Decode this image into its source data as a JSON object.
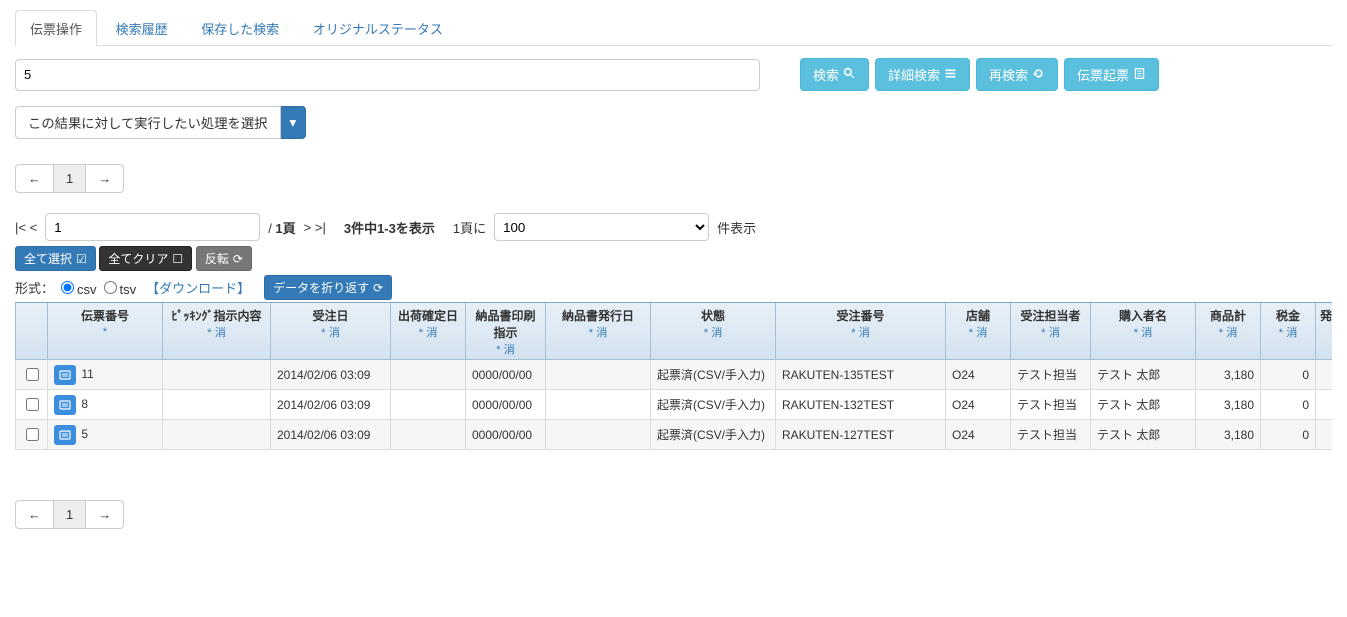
{
  "tabs": {
    "items": [
      {
        "label": "伝票操作",
        "active": true
      },
      {
        "label": "検索履歴"
      },
      {
        "label": "保存した検索"
      },
      {
        "label": "オリジナルステータス"
      }
    ]
  },
  "search": {
    "value": "5",
    "btn_search": "検索",
    "btn_advanced": "詳細検索",
    "btn_research": "再検索",
    "btn_issue": "伝票起票"
  },
  "action": {
    "label": "この結果に対して実行したい処理を選択"
  },
  "pagination": {
    "prev": "←",
    "page": "1",
    "next": "→"
  },
  "page_controls": {
    "first": "|< <",
    "page_value": "1",
    "page_total_prefix": "/ ",
    "page_total": "1頁",
    "next": "> >|",
    "count_text": "3件中1-3を表示",
    "per_page_prefix": "1頁に",
    "per_page_value": "100",
    "per_page_suffix": "件表示"
  },
  "selection": {
    "select_all": "全て選択",
    "clear_all": "全てクリア",
    "invert": "反転"
  },
  "format": {
    "label": "形式：",
    "csv": "csv",
    "tsv": "tsv",
    "download": "【ダウンロード】",
    "wrap": "データを折り返す"
  },
  "table": {
    "sort_mark": "*",
    "erase": "消",
    "headers": {
      "slip_no": "伝票番号",
      "picking": "ﾋﾟｯｷﾝｸﾞ指示内容",
      "order_date": "受注日",
      "ship_date": "出荷確定日",
      "print_mark": "納品書印刷指示",
      "issue_date": "納品書発行日",
      "state": "状態",
      "order_no": "受注番号",
      "shop": "店舗",
      "staff": "受注担当者",
      "buyer": "購入者名",
      "item_total": "商品計",
      "tax": "税金",
      "extra": "発"
    },
    "rows": [
      {
        "slip_no": "11",
        "picking": "",
        "order_date": "2014/02/06 03:09",
        "ship_date": "",
        "print_mark": "0000/00/00",
        "issue_date": "",
        "state": "起票済(CSV/手入力)",
        "order_no": "RAKUTEN-135TEST",
        "shop": "O24",
        "staff": "テスト担当",
        "buyer": "テスト 太郎",
        "item_total": "3,180",
        "tax": "0"
      },
      {
        "slip_no": "8",
        "picking": "",
        "order_date": "2014/02/06 03:09",
        "ship_date": "",
        "print_mark": "0000/00/00",
        "issue_date": "",
        "state": "起票済(CSV/手入力)",
        "order_no": "RAKUTEN-132TEST",
        "shop": "O24",
        "staff": "テスト担当",
        "buyer": "テスト 太郎",
        "item_total": "3,180",
        "tax": "0"
      },
      {
        "slip_no": "5",
        "picking": "",
        "order_date": "2014/02/06 03:09",
        "ship_date": "",
        "print_mark": "0000/00/00",
        "issue_date": "",
        "state": "起票済(CSV/手入力)",
        "order_no": "RAKUTEN-127TEST",
        "shop": "O24",
        "staff": "テスト担当",
        "buyer": "テスト 太郎",
        "item_total": "3,180",
        "tax": "0"
      }
    ]
  }
}
